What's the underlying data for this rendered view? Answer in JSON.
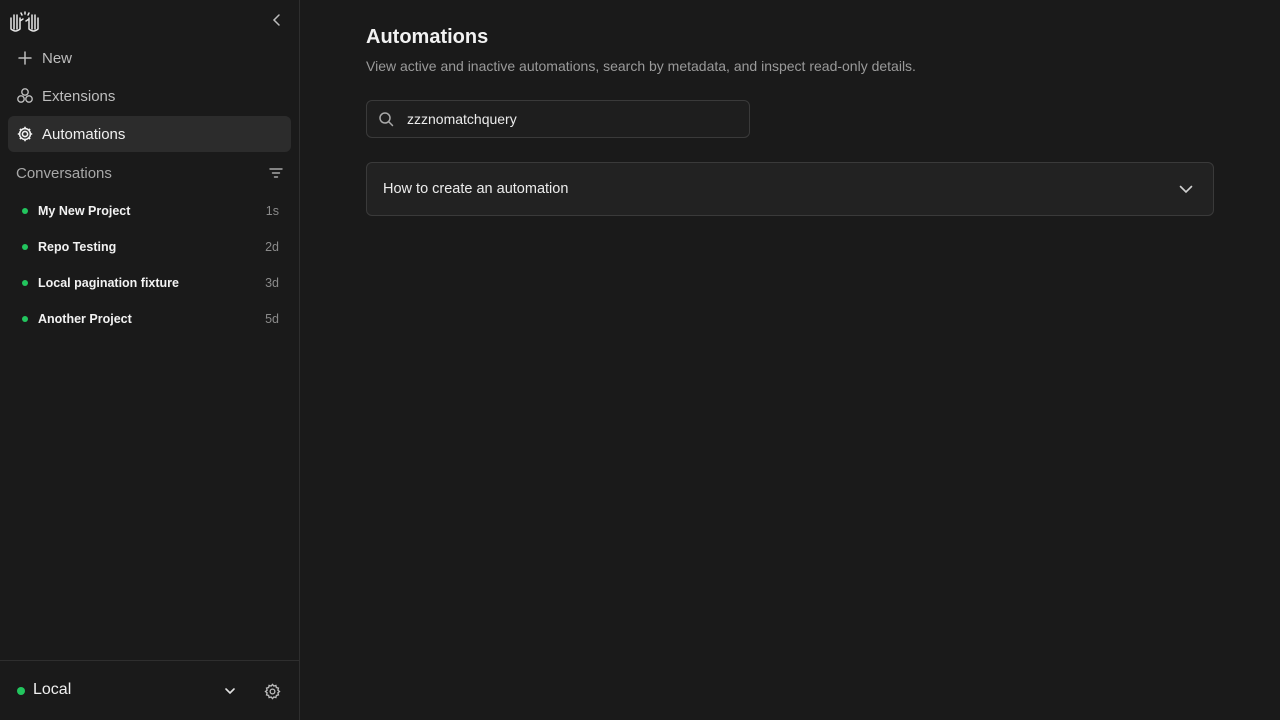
{
  "sidebar": {
    "nav": {
      "new_label": "New",
      "extensions_label": "Extensions",
      "automations_label": "Automations"
    },
    "conversations": {
      "title": "Conversations",
      "items": [
        {
          "name": "My New Project",
          "time": "1s"
        },
        {
          "name": "Repo Testing",
          "time": "2d"
        },
        {
          "name": "Local pagination fixture",
          "time": "3d"
        },
        {
          "name": "Another Project",
          "time": "5d"
        }
      ]
    },
    "footer": {
      "environment_label": "Local"
    }
  },
  "main": {
    "title": "Automations",
    "subtitle": "View active and inactive automations, search by metadata, and inspect read-only details.",
    "search": {
      "value": "zzznomatchquery"
    },
    "accordion": {
      "label": "How to create an automation"
    }
  },
  "colors": {
    "background": "#1a1a1a",
    "active_item": "#2c2c2c",
    "status_green": "#22c55e",
    "border": "#3a3a3a"
  },
  "icons": [
    "hands-logo-icon",
    "chevron-left-icon",
    "plus-icon",
    "extensions-icon",
    "gear-icon",
    "filter-icon",
    "chevron-down-icon",
    "settings-icon",
    "search-icon"
  ]
}
